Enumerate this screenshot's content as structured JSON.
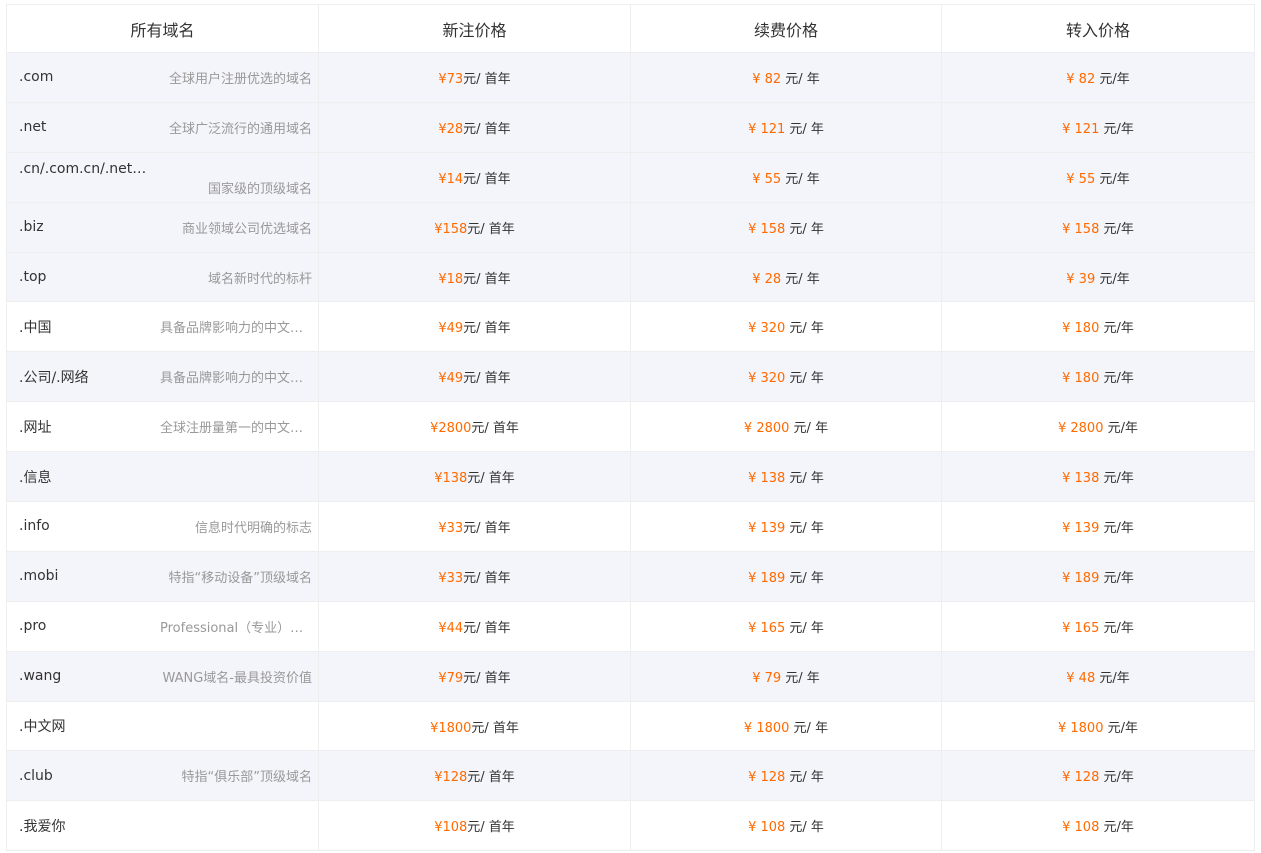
{
  "headers": {
    "domain": "所有域名",
    "new": "新注价格",
    "renew": "续费价格",
    "transfer": "转入价格"
  },
  "colors": {
    "accent": "#ff6a00",
    "row_shade": "#f4f4fb",
    "border": "#eeeeee",
    "desc_text": "#999999"
  },
  "rows": [
    {
      "suffix": ".com",
      "desc": "全球用户注册优选的域名",
      "new": "¥73",
      "new_unit": "元/ 首年",
      "renew": "¥ 82",
      "renew_unit": " 元/ 年",
      "transfer": "¥ 82",
      "transfer_unit": " 元/年"
    },
    {
      "suffix": ".net",
      "desc": "全球广泛流行的通用域名",
      "new": "¥28",
      "new_unit": "元/ 首年",
      "renew": "¥ 121",
      "renew_unit": " 元/ 年",
      "transfer": "¥ 121",
      "transfer_unit": " 元/年"
    },
    {
      "suffix": ".cn/.com.cn/.net.cn/.org.cn",
      "desc": "国家级的顶级域名",
      "new": "¥14",
      "new_unit": "元/ 首年",
      "renew": "¥ 55",
      "renew_unit": " 元/ 年",
      "transfer": "¥ 55",
      "transfer_unit": " 元/年"
    },
    {
      "suffix": ".biz",
      "desc": "商业领域公司优选域名",
      "new": "¥158",
      "new_unit": "元/ 首年",
      "renew": "¥ 158",
      "renew_unit": " 元/ 年",
      "transfer": "¥ 158",
      "transfer_unit": " 元/年"
    },
    {
      "suffix": ".top",
      "desc": "域名新时代的标杆",
      "new": "¥18",
      "new_unit": "元/ 首年",
      "renew": "¥ 28",
      "renew_unit": " 元/ 年",
      "transfer": "¥ 39",
      "transfer_unit": " 元/年"
    },
    {
      "suffix": ".中国",
      "desc": "具备品牌影响力的中文域名",
      "new": "¥49",
      "new_unit": "元/ 首年",
      "renew": "¥ 320",
      "renew_unit": " 元/ 年",
      "transfer": "¥ 180",
      "transfer_unit": " 元/年"
    },
    {
      "suffix": ".公司/.网络",
      "desc": "具备品牌影响力的中文域名",
      "new": "¥49",
      "new_unit": "元/ 首年",
      "renew": "¥ 320",
      "renew_unit": " 元/ 年",
      "transfer": "¥ 180",
      "transfer_unit": " 元/年"
    },
    {
      "suffix": ".网址",
      "desc": "全球注册量第一的中文域名",
      "new": "¥2800",
      "new_unit": "元/ 首年",
      "renew": "¥ 2800",
      "renew_unit": " 元/ 年",
      "transfer": "¥ 2800",
      "transfer_unit": " 元/年"
    },
    {
      "suffix": ".信息",
      "desc": "",
      "new": "¥138",
      "new_unit": "元/ 首年",
      "renew": "¥ 138",
      "renew_unit": " 元/ 年",
      "transfer": "¥ 138",
      "transfer_unit": " 元/年"
    },
    {
      "suffix": ".info",
      "desc": "信息时代明确的标志",
      "new": "¥33",
      "new_unit": "元/ 首年",
      "renew": "¥ 139",
      "renew_unit": " 元/ 年",
      "transfer": "¥ 139",
      "transfer_unit": " 元/年"
    },
    {
      "suffix": ".mobi",
      "desc": "特指“移动设备”顶级域名",
      "new": "¥33",
      "new_unit": "元/ 首年",
      "renew": "¥ 189",
      "renew_unit": " 元/ 年",
      "transfer": "¥ 189",
      "transfer_unit": " 元/年"
    },
    {
      "suffix": ".pro",
      "desc": "Professional（专业）域名",
      "new": "¥44",
      "new_unit": "元/ 首年",
      "renew": "¥ 165",
      "renew_unit": " 元/ 年",
      "transfer": "¥ 165",
      "transfer_unit": " 元/年"
    },
    {
      "suffix": ".wang",
      "desc": "WANG域名-最具投资价值",
      "new": "¥79",
      "new_unit": "元/ 首年",
      "renew": "¥ 79",
      "renew_unit": " 元/ 年",
      "transfer": "¥ 48",
      "transfer_unit": " 元/年"
    },
    {
      "suffix": ".中文网",
      "desc": "",
      "new": "¥1800",
      "new_unit": "元/ 首年",
      "renew": "¥ 1800",
      "renew_unit": " 元/ 年",
      "transfer": "¥ 1800",
      "transfer_unit": " 元/年"
    },
    {
      "suffix": ".club",
      "desc": "特指“俱乐部”顶级域名",
      "new": "¥128",
      "new_unit": "元/ 首年",
      "renew": "¥ 128",
      "renew_unit": " 元/ 年",
      "transfer": "¥ 128",
      "transfer_unit": " 元/年"
    },
    {
      "suffix": ".我爱你",
      "desc": "",
      "new": "¥108",
      "new_unit": "元/ 首年",
      "renew": "¥ 108",
      "renew_unit": " 元/ 年",
      "transfer": "¥ 108",
      "transfer_unit": " 元/年"
    }
  ]
}
